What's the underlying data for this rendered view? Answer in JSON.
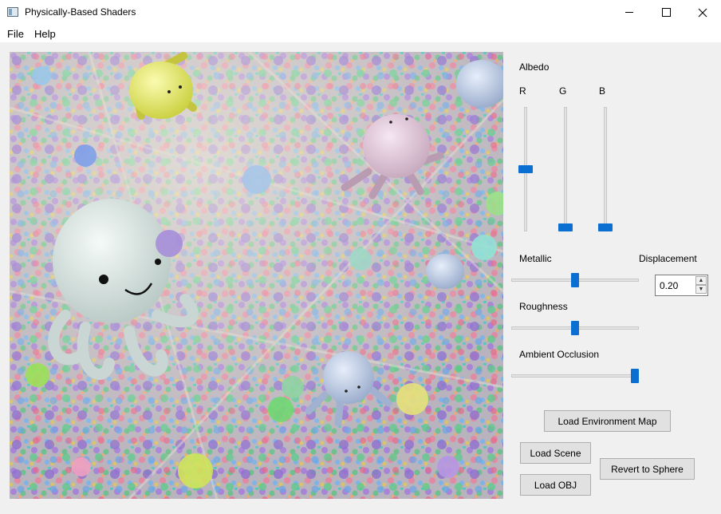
{
  "window": {
    "title": "Physically-Based Shaders"
  },
  "menu": [
    "File",
    "Help"
  ],
  "panel": {
    "albedo_label": "Albedo",
    "r_label": "R",
    "g_label": "G",
    "b_label": "B",
    "albedo": {
      "r": 0.5,
      "g": 0.0,
      "b": 0.0
    },
    "metallic_label": "Metallic",
    "metallic": 0.5,
    "displacement_label": "Displacement",
    "displacement_value": "0.20",
    "roughness_label": "Roughness",
    "roughness": 0.5,
    "ao_label": "Ambient Occlusion",
    "ambient_occlusion": 1.0
  },
  "buttons": {
    "load_env_map": "Load Environment Map",
    "load_scene": "Load Scene",
    "load_obj": "Load OBJ",
    "revert_sphere": "Revert to Sphere"
  }
}
